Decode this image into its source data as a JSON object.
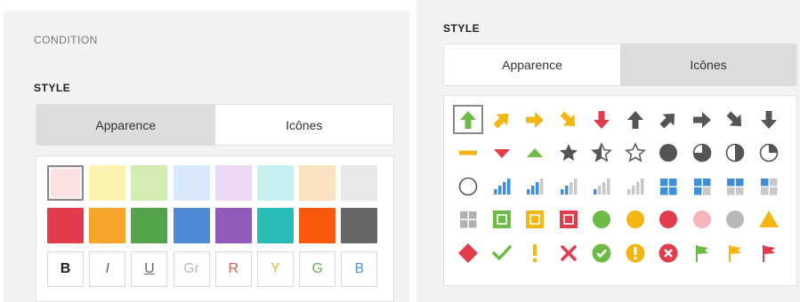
{
  "left": {
    "condition_label": "CONDITION",
    "style_label": "STYLE",
    "tabs": [
      {
        "label": "Apparence",
        "active": true
      },
      {
        "label": "Icônes",
        "active": false
      }
    ],
    "light_colors": [
      "#fde1e2",
      "#fdf3b1",
      "#d4ecb2",
      "#d9e8fb",
      "#ecd9f5",
      "#c7f1f1",
      "#fbe1bf",
      "#e8e8e8"
    ],
    "dark_colors": [
      "#e23b4b",
      "#f6a52a",
      "#53a34b",
      "#4e89d6",
      "#8f5ab9",
      "#27bdb6",
      "#fa580d",
      "#666666"
    ],
    "selected_swatch_index": 0,
    "format_buttons": [
      {
        "label": "B",
        "color": "#222222",
        "style": "bold"
      },
      {
        "label": "I",
        "color": "#666666",
        "style": "italic"
      },
      {
        "label": "U",
        "color": "#666666",
        "style": "underline"
      },
      {
        "label": "Gr",
        "color": "#bbbbbb",
        "style": "normal"
      },
      {
        "label": "R",
        "color": "#d9575d",
        "style": "normal"
      },
      {
        "label": "Y",
        "color": "#e8b23a",
        "style": "normal"
      },
      {
        "label": "G",
        "color": "#5fb45a",
        "style": "normal"
      },
      {
        "label": "B",
        "color": "#5b8fd6",
        "style": "normal"
      }
    ]
  },
  "right": {
    "style_label": "STYLE",
    "tabs": [
      {
        "label": "Apparence",
        "active": false
      },
      {
        "label": "Icônes",
        "active": true
      }
    ],
    "selected_icon_index": 0,
    "icons": [
      [
        "arrow-up-green-icon",
        "arrow-up-right-orange-icon",
        "arrow-right-orange-icon",
        "arrow-down-right-orange-icon",
        "arrow-down-red-icon",
        "arrow-up-gray-icon",
        "arrow-up-right-gray-icon",
        "arrow-right-gray-icon",
        "arrow-down-right-gray-icon",
        "arrow-down-gray-icon"
      ],
      [
        "dash-yellow-icon",
        "triangle-down-red-icon",
        "triangle-up-green-icon",
        "star-full-icon",
        "star-half-icon",
        "star-empty-icon",
        "circle-full-gray-icon",
        "circle-three-quarter-icon",
        "circle-half-icon",
        "circle-quarter-icon"
      ],
      [
        "circle-empty-icon",
        "signal-4-icon",
        "signal-3-icon",
        "signal-2-icon",
        "signal-1-icon",
        "signal-0-icon",
        "grid-4-blue-icon",
        "grid-3-blue-icon",
        "grid-2-blue-icon",
        "grid-1-blue-icon"
      ],
      [
        "grid-0-gray-icon",
        "square-green-icon",
        "square-yellow-icon",
        "square-red-icon",
        "circle-green-icon",
        "circle-yellow-icon",
        "circle-red-icon",
        "circle-pink-icon",
        "circle-gray-icon",
        "triangle-warning-icon"
      ],
      [
        "diamond-red-icon",
        "checkmark-green-icon",
        "exclamation-orange-icon",
        "cross-red-icon",
        "circle-check-green-icon",
        "circle-exclamation-yellow-icon",
        "circle-cross-red-icon",
        "flag-green-icon",
        "flag-yellow-icon",
        "flag-red-icon"
      ]
    ]
  }
}
